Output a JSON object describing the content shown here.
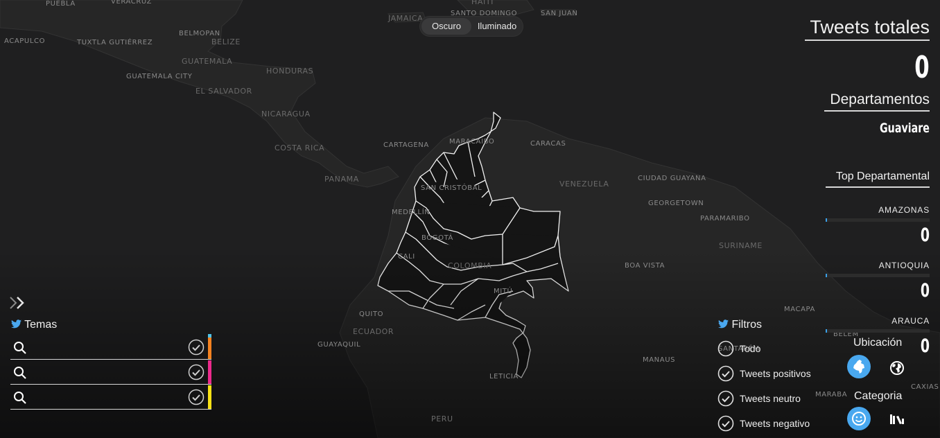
{
  "theme_toggle": {
    "dark_label": "Oscuro",
    "light_label": "Iluminado",
    "selected": "Oscuro"
  },
  "map": {
    "city_labels": {
      "puebla": "PUEBLA",
      "veracruz": "VERACRUZ",
      "jamaica": "JAMAICA",
      "haiti": "HAITI",
      "santo_domingo": "SANTO DOMINGO",
      "san_juan": "SAN JUAN",
      "acapulco": "ACAPULCO",
      "tuxtla": "TUXTLA GUTIÉRREZ",
      "belmopan": "BELMOPAN",
      "guatemala_city": "GUATEMALA CITY",
      "cartagena": "CARTAGENA",
      "maracaibo": "MARACAIBO",
      "caracas": "CARACAS",
      "san_cristobal": "SAN CRISTÓBAL",
      "medellin": "MEDELLÍN",
      "bogota": "BOGOTÁ",
      "cali": "CALI",
      "quito": "QUITO",
      "guayaquil": "GUAYAQUIL",
      "mitu": "MITÚ",
      "leticia": "LETICIA",
      "ciudad_guayana": "CIUDAD GUAYANA",
      "georgetown": "GEORGETOWN",
      "paramaribo": "PARAMARIBO",
      "boa_vista": "BOA VISTA",
      "macapa": "MACAPA",
      "manaus": "MANAUS",
      "belem": "BELÉM",
      "maraba": "MARABA",
      "caxias": "CAXIAS",
      "santarem": "SANTARÉM"
    },
    "country_labels": {
      "belize": "BELIZE",
      "guatemala": "GUATEMALA",
      "honduras": "HONDURAS",
      "el_salvador": "EL SALVADOR",
      "nicaragua": "NICARAGUA",
      "costa_rica": "COSTA RICA",
      "panama": "PANAMA",
      "venezuela": "VENEZUELA",
      "colombia": "COLOMBIA",
      "ecuador": "ECUADOR",
      "suriname": "SURINAME",
      "peru": "PERU"
    }
  },
  "summary": {
    "total_title": "Tweets totales",
    "total_count": "0",
    "departments_title": "Departamentos",
    "selected_department": "Guaviare",
    "top_title": "Top Departamental",
    "top": [
      {
        "name": "AMAZONAS",
        "value": "0",
        "fill": 0.01
      },
      {
        "name": "ANTIOQUIA",
        "value": "0",
        "fill": 0.01
      },
      {
        "name": "ARAUCA",
        "value": "0",
        "fill": 0.01
      }
    ]
  },
  "ubicacion": {
    "title": "Ubicación",
    "options": [
      "colombia-map-icon",
      "globe-icon"
    ],
    "active": "colombia-map-icon"
  },
  "categoria": {
    "title": "Categoria",
    "options": [
      "smiley-icon",
      "books-icon"
    ],
    "active": "smiley-icon"
  },
  "temas": {
    "title": "Temas",
    "rows": [
      {
        "value": "",
        "color": "#f58220",
        "accent": "#4fc3e8"
      },
      {
        "value": "",
        "color": "#ec2a8c"
      },
      {
        "value": "",
        "color": "#f7e115"
      }
    ]
  },
  "filtros": {
    "title": "Filtros",
    "items": [
      {
        "label": "Todo",
        "checked": false
      },
      {
        "label": "Tweets positivos",
        "checked": true
      },
      {
        "label": "Tweets neutro",
        "checked": true
      },
      {
        "label": "Tweets negativo",
        "checked": true
      }
    ]
  },
  "colors": {
    "accent": "#49a8ef",
    "twitter": "#4aa8f0",
    "background": "#1f1f20",
    "land": "#262626",
    "water": "#1f1f20"
  }
}
